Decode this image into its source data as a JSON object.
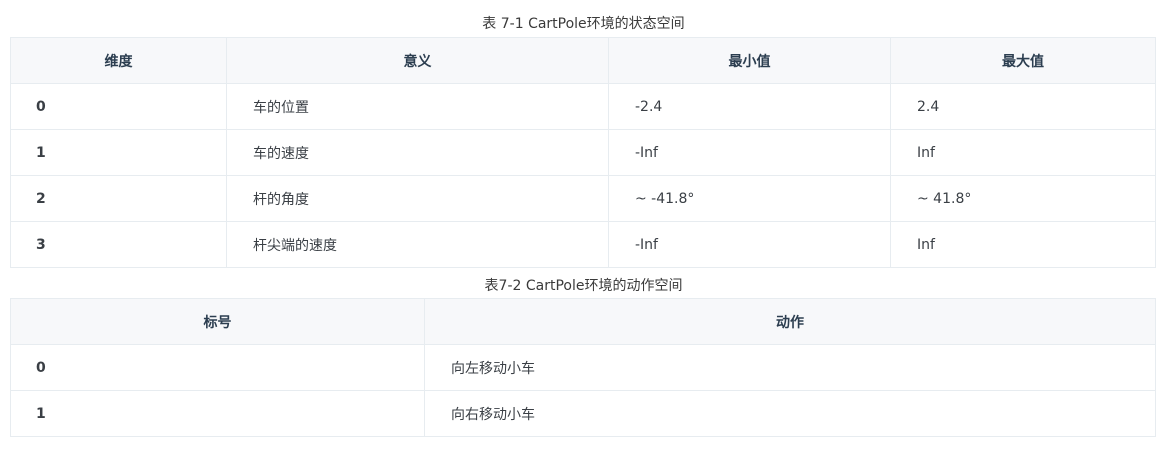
{
  "table1": {
    "caption": "表 7-1 CartPole环境的状态空间",
    "headers": [
      "维度",
      "意义",
      "最小值",
      "最大值"
    ],
    "rows": [
      [
        "0",
        "车的位置",
        "-2.4",
        "2.4"
      ],
      [
        "1",
        "车的速度",
        "-Inf",
        "Inf"
      ],
      [
        "2",
        "杆的角度",
        "~ -41.8°",
        "~ 41.8°"
      ],
      [
        "3",
        "杆尖端的速度",
        "-Inf",
        "Inf"
      ]
    ]
  },
  "table2": {
    "caption": "表7-2 CartPole环境的动作空间",
    "headers": [
      "标号",
      "动作"
    ],
    "rows": [
      [
        "0",
        "向左移动小车"
      ],
      [
        "1",
        "向右移动小车"
      ]
    ]
  }
}
